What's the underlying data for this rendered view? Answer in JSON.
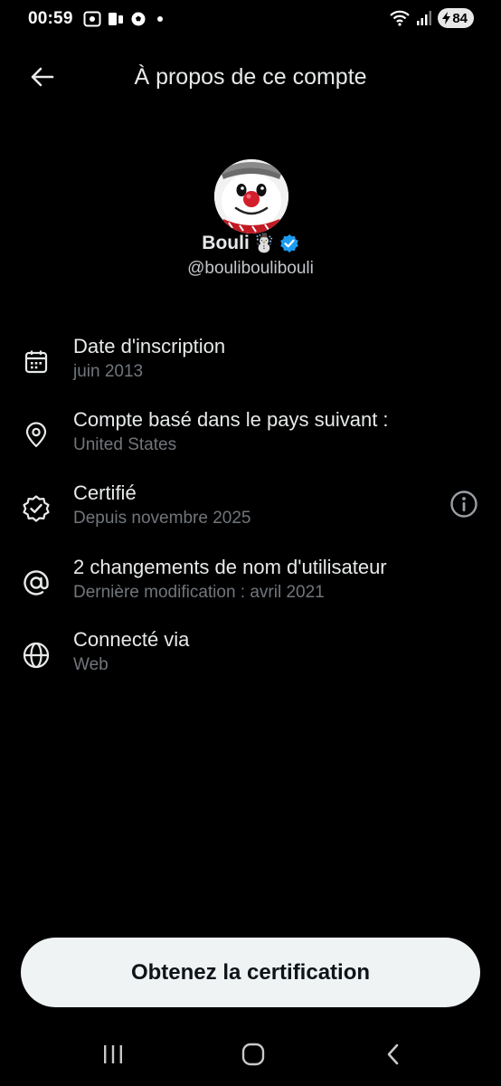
{
  "status_bar": {
    "time": "00:59",
    "battery": "84"
  },
  "header": {
    "title": "À propos de ce compte"
  },
  "profile": {
    "name": "Bouli",
    "name_emoji": "☃️",
    "handle": "@boulibouliboul i",
    "verified_color": "#1d9bf0"
  },
  "info": [
    {
      "icon": "calendar-icon",
      "title": "Date d'inscription",
      "subtitle": "juin 2013"
    },
    {
      "icon": "location-pin-icon",
      "title": "Compte basé dans le pays suivant :",
      "subtitle": "United States"
    },
    {
      "icon": "verified-badge-icon",
      "title": "Certifié",
      "subtitle": "Depuis novembre 2025"
    },
    {
      "icon": "at-sign-icon",
      "title": "2 changements de nom d'utilisateur",
      "subtitle": "Dernière modification : avril 2021"
    },
    {
      "icon": "globe-icon",
      "title": "Connecté via",
      "subtitle": "Web"
    }
  ],
  "cta": {
    "label": "Obtenez la certification"
  },
  "colors": {
    "background": "#000000",
    "primary_text": "#e7e9ea",
    "secondary_text": "#71767b",
    "button_bg": "#eff3f4",
    "button_text": "#0f1419"
  }
}
